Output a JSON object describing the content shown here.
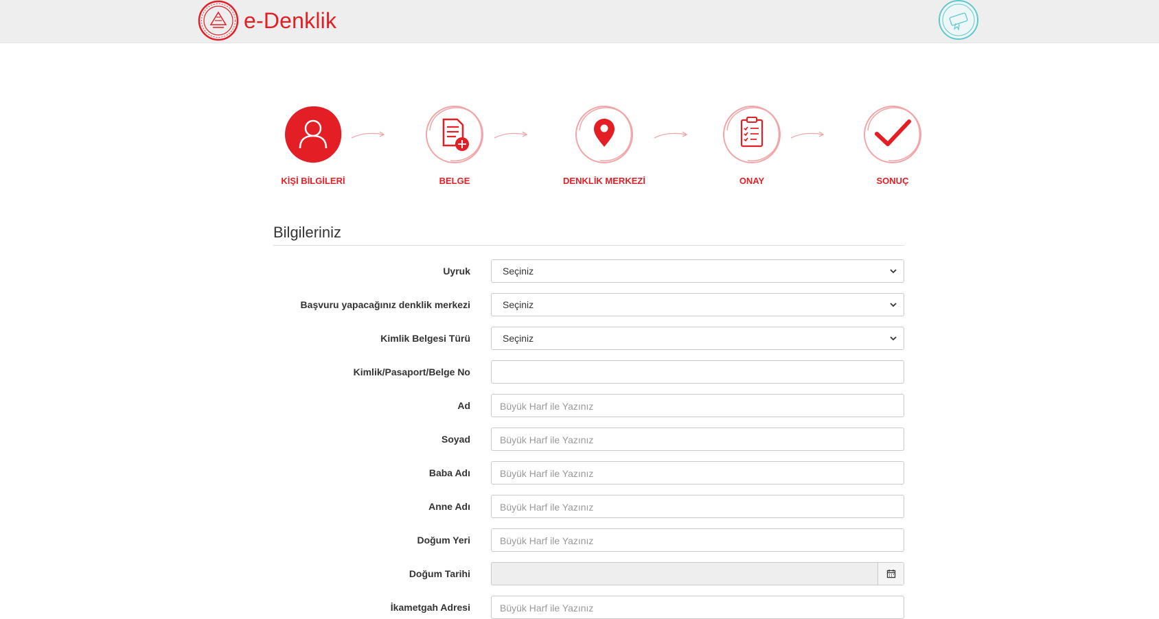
{
  "header": {
    "brand": "e-Denklik",
    "colors": {
      "brand": "#e31e24",
      "seal": "#5fc7cf",
      "header_bg": "#eeeeee"
    }
  },
  "steps": [
    {
      "label": "KİŞİ BİLGİLERİ",
      "icon": "user-icon",
      "active": true
    },
    {
      "label": "BELGE",
      "icon": "document-add-icon",
      "active": false
    },
    {
      "label": "DENKLİK MERKEZİ",
      "icon": "location-pin-icon",
      "active": false
    },
    {
      "label": "ONAY",
      "icon": "clipboard-checklist-icon",
      "active": false
    },
    {
      "label": "SONUÇ",
      "icon": "checkmark-icon",
      "active": false
    }
  ],
  "form": {
    "title": "Bilgileriniz",
    "fields": {
      "uyruk": {
        "label": "Uyruk",
        "value": "Seçiniz"
      },
      "merkez": {
        "label": "Başvuru yapacağınız denklik merkezi",
        "value": "Seçiniz"
      },
      "kimlik_turu": {
        "label": "Kimlik Belgesi Türü",
        "value": "Seçiniz"
      },
      "kimlik_no": {
        "label": "Kimlik/Pasaport/Belge No",
        "value": ""
      },
      "ad": {
        "label": "Ad",
        "placeholder": "Büyük Harf ile Yazınız"
      },
      "soyad": {
        "label": "Soyad",
        "placeholder": "Büyük Harf ile Yazınız"
      },
      "baba_adi": {
        "label": "Baba Adı",
        "placeholder": "Büyük Harf ile Yazınız"
      },
      "anne_adi": {
        "label": "Anne Adı",
        "placeholder": "Büyük Harf ile Yazınız"
      },
      "dogum_yeri": {
        "label": "Doğum Yeri",
        "placeholder": "Büyük Harf ile Yazınız"
      },
      "dogum_tarihi": {
        "label": "Doğum Tarihi",
        "value": "",
        "icon": "calendar-icon"
      },
      "ikametgah": {
        "label": "İkametgah Adresi",
        "placeholder": "Büyük Harf ile Yazınız"
      }
    }
  }
}
